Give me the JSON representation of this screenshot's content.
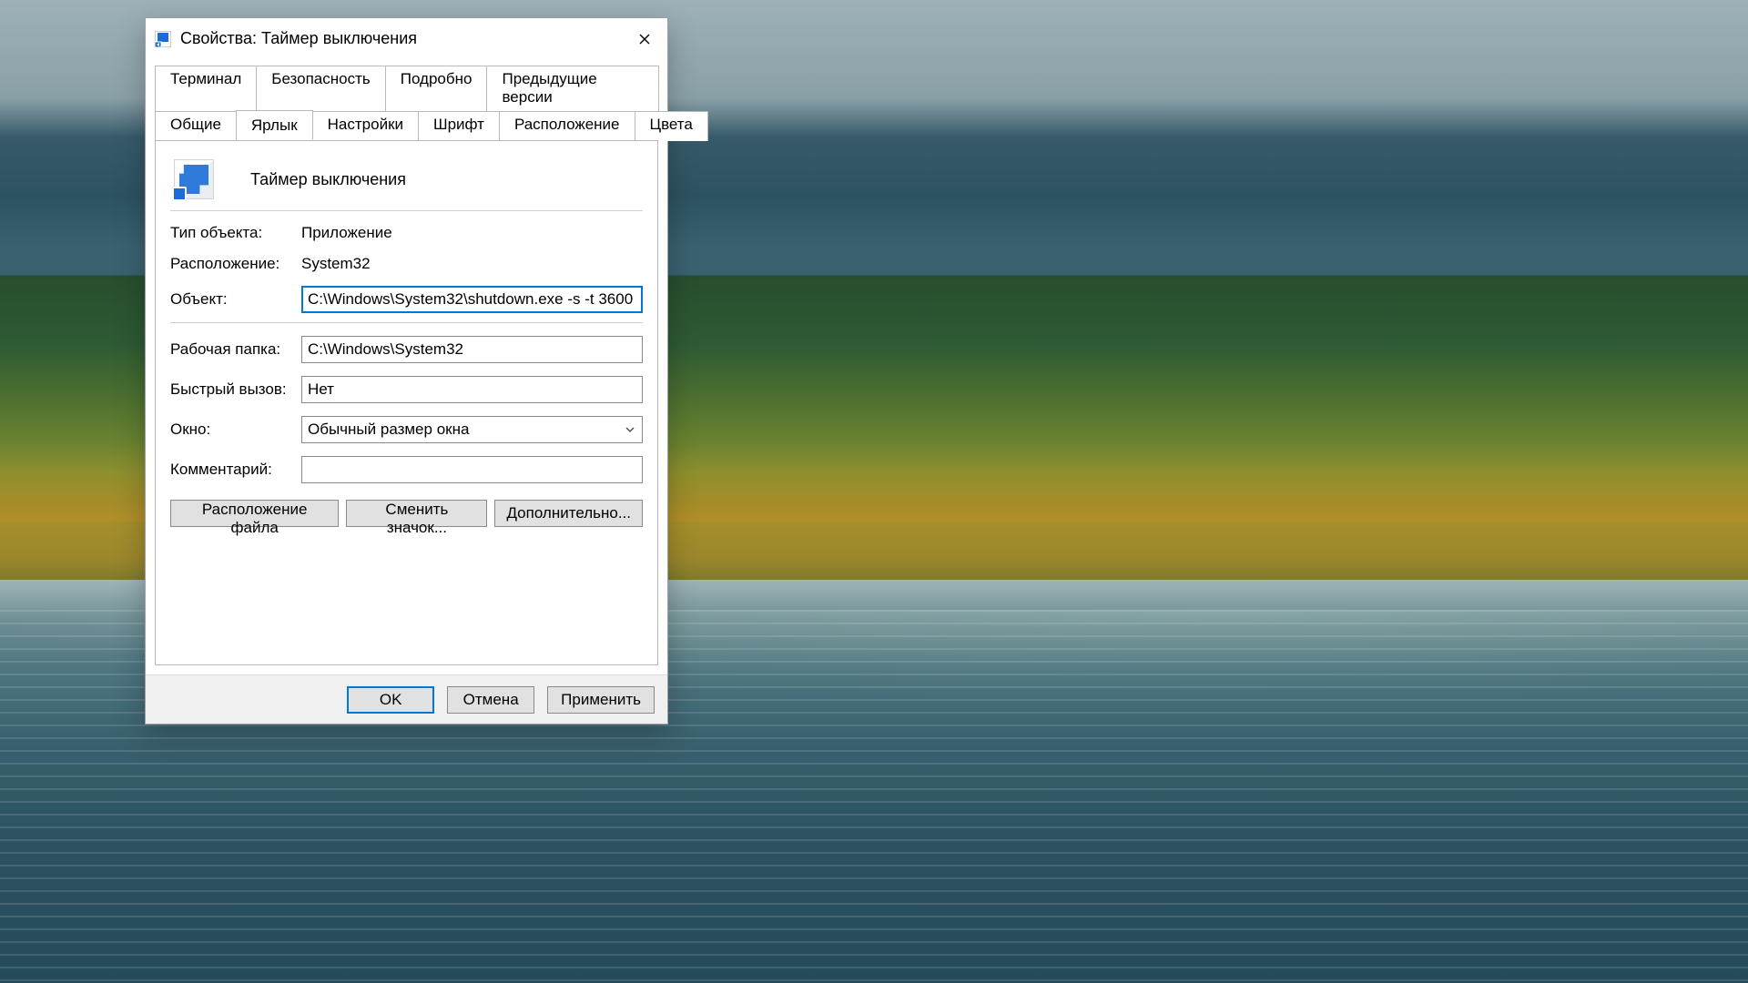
{
  "window": {
    "title": "Свойства: Таймер выключения"
  },
  "tabs": {
    "row1": [
      {
        "id": "terminal",
        "label": "Терминал"
      },
      {
        "id": "security",
        "label": "Безопасность"
      },
      {
        "id": "details",
        "label": "Подробно"
      },
      {
        "id": "previous",
        "label": "Предыдущие версии"
      }
    ],
    "row2": [
      {
        "id": "general",
        "label": "Общие"
      },
      {
        "id": "shortcut",
        "label": "Ярлык"
      },
      {
        "id": "settings",
        "label": "Настройки"
      },
      {
        "id": "font",
        "label": "Шрифт"
      },
      {
        "id": "layout",
        "label": "Расположение"
      },
      {
        "id": "colors",
        "label": "Цвета"
      }
    ],
    "active": "shortcut"
  },
  "panel": {
    "header": "Таймер выключения",
    "labels": {
      "type": "Тип объекта:",
      "location": "Расположение:",
      "target": "Объект:",
      "startin": "Рабочая папка:",
      "hotkey": "Быстрый вызов:",
      "run": "Окно:",
      "comment": "Комментарий:"
    },
    "values": {
      "type": "Приложение",
      "location": "System32",
      "target": "C:\\Windows\\System32\\shutdown.exe -s -t 3600",
      "startin": "C:\\Windows\\System32",
      "hotkey": "Нет",
      "run": "Обычный размер окна",
      "comment": ""
    },
    "buttons": {
      "open_file_location": "Расположение файла",
      "change_icon": "Сменить значок...",
      "advanced": "Дополнительно..."
    }
  },
  "footer": {
    "ok": "OK",
    "cancel": "Отмена",
    "apply": "Применить"
  }
}
